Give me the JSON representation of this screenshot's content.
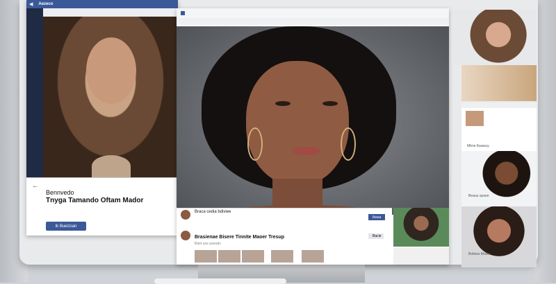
{
  "left_panel": {
    "brand": "Aezeco",
    "card": {
      "line1": "Bennvedo",
      "line2": "Tnyga Tamando Oftam Mador",
      "line3": "",
      "button": "Ik Bueizsan"
    }
  },
  "center_panel": {
    "post1": {
      "name": "Braca cedia bdiviee",
      "sub": "",
      "button": "Ibasa"
    },
    "post2": {
      "title": "Brasienae Bisere Tinnite Maoer Tresup",
      "sub": "Bdet aoe paeadn",
      "button": "Bacie"
    }
  },
  "right_panel": {
    "r3_label": "Mbne Ibaaouy",
    "r4_label": "Beauu ayaoe",
    "r5_label": "Botloss Moder"
  },
  "colors": {
    "accent": "#3b5998",
    "dark_side": "#1f2a44"
  }
}
